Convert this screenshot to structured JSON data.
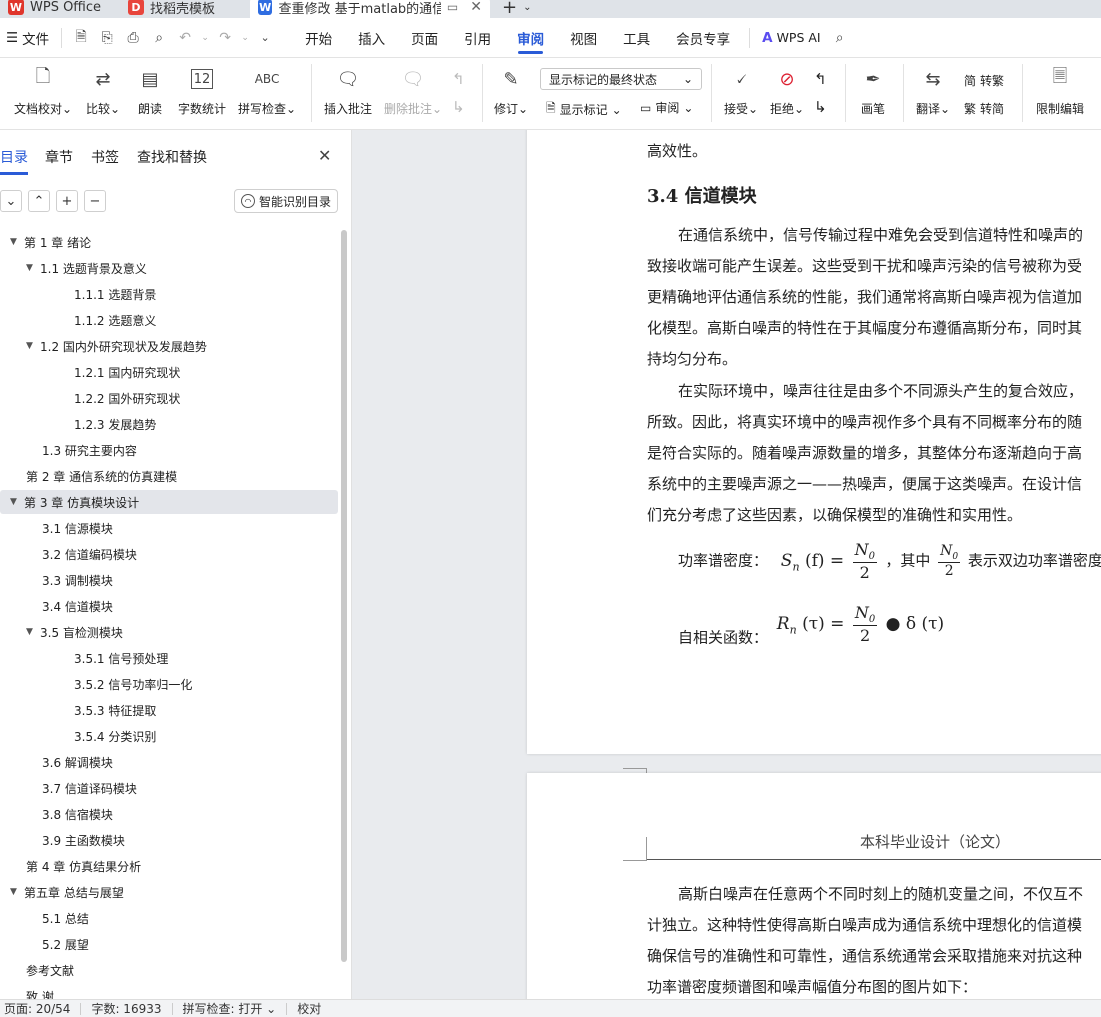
{
  "tabs": [
    {
      "label": "WPS Office"
    },
    {
      "label": "找稻壳模板"
    },
    {
      "label": "查重修改 基于matlab的通信仿"
    }
  ],
  "menu": {
    "file_label": "文件",
    "items": [
      "开始",
      "插入",
      "页面",
      "引用",
      "审阅",
      "视图",
      "工具",
      "会员专享"
    ],
    "active_index": 4,
    "wps_ai_label": "WPS AI"
  },
  "ribbon": {
    "doc_check": "文档校对",
    "compare": "比较",
    "read_aloud": "朗读",
    "word_count": "字数统计",
    "spell_check": "拼写检查",
    "insert_comment": "插入批注",
    "delete_comment": "删除批注",
    "revise": "修订",
    "display_mode": "显示标记的最终状态",
    "show_markup": "显示标记",
    "review": "审阅",
    "accept": "接受",
    "reject": "拒绝",
    "pen": "画笔",
    "translate": "翻译",
    "to_traditional": "转繁",
    "to_simplified": "转简",
    "restrict_edit": "限制编辑"
  },
  "nav": {
    "tabs": [
      "目录",
      "章节",
      "书签",
      "查找和替换"
    ],
    "smart_toc": "智能识别目录",
    "toc": [
      {
        "label": "第 1 章  绪论",
        "level": 0,
        "arrow": true
      },
      {
        "label": "1.1 选题背景及意义",
        "level": 1,
        "arrow": true
      },
      {
        "label": "1.1.1 选题背景",
        "level": 2,
        "arrow": false
      },
      {
        "label": "1.1.2 选题意义",
        "level": 2,
        "arrow": false
      },
      {
        "label": "1.2 国内外研究现状及发展趋势",
        "level": 1,
        "arrow": true
      },
      {
        "label": "1.2.1 国内研究现状",
        "level": 2,
        "arrow": false
      },
      {
        "label": "1.2.2 国外研究现状",
        "level": 2,
        "arrow": false
      },
      {
        "label": "1.2.3 发展趋势",
        "level": 2,
        "arrow": false
      },
      {
        "label": "1.3 研究主要内容",
        "level": 1,
        "arrow": false
      },
      {
        "label": "第 2 章  通信系统的仿真建模",
        "level": 0,
        "arrow": false
      },
      {
        "label": "第 3 章  仿真模块设计",
        "level": 0,
        "arrow": true,
        "selected": true
      },
      {
        "label": "3.1 信源模块",
        "level": 1,
        "arrow": false
      },
      {
        "label": "3.2 信道编码模块",
        "level": 1,
        "arrow": false
      },
      {
        "label": "3.3 调制模块",
        "level": 1,
        "arrow": false
      },
      {
        "label": "3.4 信道模块",
        "level": 1,
        "arrow": false
      },
      {
        "label": "3.5 盲检测模块",
        "level": 1,
        "arrow": true
      },
      {
        "label": "3.5.1 信号预处理",
        "level": 2,
        "arrow": false
      },
      {
        "label": "3.5.2 信号功率归一化",
        "level": 2,
        "arrow": false
      },
      {
        "label": "3.5.3 特征提取",
        "level": 2,
        "arrow": false
      },
      {
        "label": "3.5.4 分类识别",
        "level": 2,
        "arrow": false
      },
      {
        "label": "3.6  解调模块",
        "level": 1,
        "arrow": false
      },
      {
        "label": "3.7 信道译码模块",
        "level": 1,
        "arrow": false
      },
      {
        "label": "3.8 信宿模块",
        "level": 1,
        "arrow": false
      },
      {
        "label": "3.9  主函数模块",
        "level": 1,
        "arrow": false
      },
      {
        "label": "第 4 章  仿真结果分析",
        "level": 0,
        "arrow": false
      },
      {
        "label": "第五章  总结与展望",
        "level": 0,
        "arrow": true
      },
      {
        "label": "5.1 总结",
        "level": 1,
        "arrow": false
      },
      {
        "label": "5.2 展望",
        "level": 1,
        "arrow": false
      },
      {
        "label": "参考文献",
        "level": 0,
        "arrow": false
      },
      {
        "label": "致    谢",
        "level": 0,
        "arrow": false
      }
    ]
  },
  "doc": {
    "page1": {
      "top_line": "高效性。",
      "heading": "3.4 信道模块",
      "para1": [
        "在通信系统中，信号传输过程中难免会受到信道特性和噪声的",
        "致接收端可能产生误差。这些受到干扰和噪声污染的信号被称为受",
        "更精确地评估通信系统的性能，我们通常将高斯白噪声视为信道加",
        "化模型。高斯白噪声的特性在于其幅度分布遵循高斯分布，同时其",
        "持均匀分布。"
      ],
      "para2": [
        "在实际环境中，噪声往往是由多个不同源头产生的复合效应，",
        "所致。因此，将真实环境中的噪声视作多个具有不同概率分布的随",
        "是符合实际的。随着噪声源数量的增多，其整体分布逐渐趋向于高",
        "系统中的主要噪声源之一——热噪声，便属于这类噪声。在设计信",
        "们充分考虑了这些因素，以确保模型的准确性和实用性。"
      ],
      "psd_label": "功率谱密度：",
      "psd_lhs": "S",
      "psd_sub": "n",
      "psd_arg": "(f) =",
      "frac_num": "N",
      "frac_num_sub": "0",
      "frac_den": "2",
      "psd_mid": "，其中",
      "psd_desc": "表示双边功率谱密度",
      "acf_label": "自相关函数：",
      "acf_lhs": "R",
      "acf_sub": "n",
      "acf_arg": "(τ) =",
      "acf_rhs": "● δ (τ)",
      "page_number": "13"
    },
    "page2": {
      "header": "本科毕业设计（论文）",
      "para": [
        "高斯白噪声在任意两个不同时刻上的随机变量之间，不仅互不",
        "计独立。这种特性使得高斯白噪声成为通信系统中理想化的信道模",
        "确保信号的准确性和可靠性，通信系统通常会采取措施来对抗这种",
        "功率谱密度频谱图和噪声幅值分布图的图片如下："
      ]
    }
  },
  "status": {
    "page": "页面: 20/54",
    "words": "字数: 16933",
    "spell": "拼写检查: 打开",
    "proof": "校对"
  },
  "colors": {
    "accent": "#2a5bd7",
    "wps_red": "#e0362c",
    "docer_red": "#e8453c",
    "writer_blue": "#2f6de1"
  }
}
